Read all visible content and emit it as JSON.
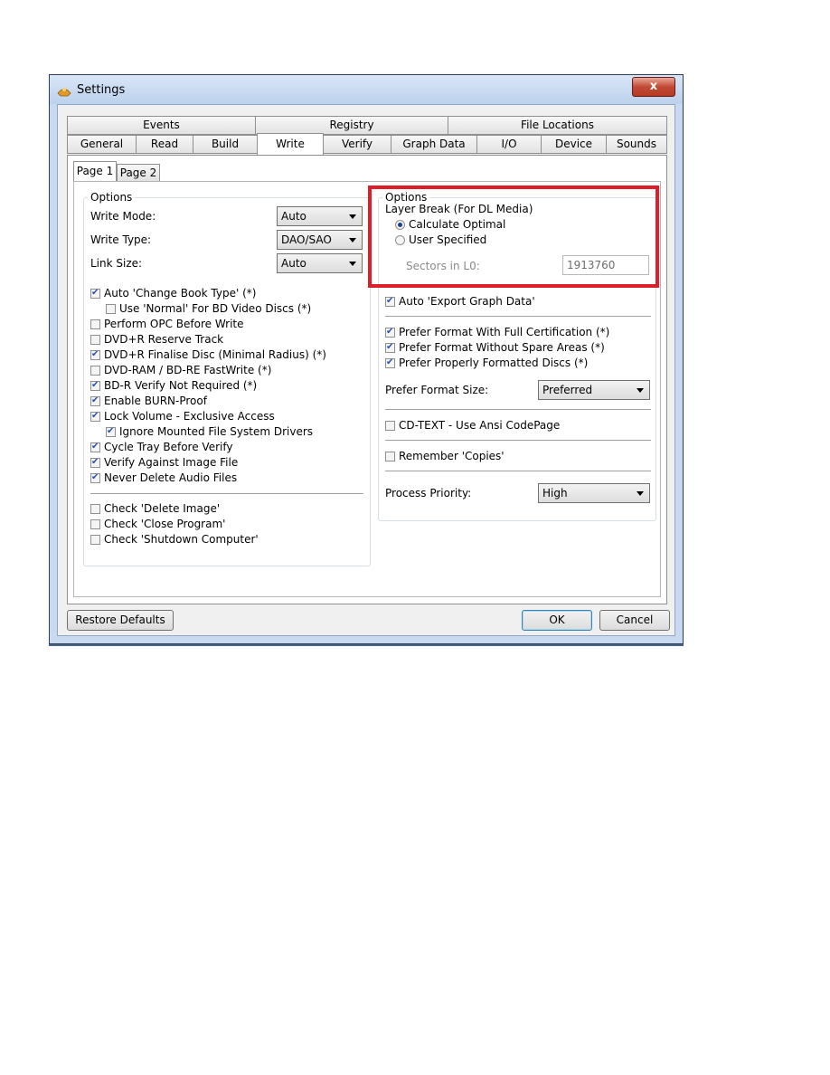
{
  "window": {
    "title": "Settings",
    "close_label": "x"
  },
  "tabs": {
    "row1": [
      "Events",
      "Registry",
      "File Locations"
    ],
    "row2": [
      "General",
      "Read",
      "Build",
      "Write",
      "Verify",
      "Graph Data",
      "I/O",
      "Device",
      "Sounds"
    ],
    "active": "Write"
  },
  "subtabs": [
    "Page 1",
    "Page 2"
  ],
  "left_options": {
    "legend": "Options",
    "write_mode": {
      "label": "Write Mode:",
      "value": "Auto"
    },
    "write_type": {
      "label": "Write Type:",
      "value": "DAO/SAO"
    },
    "link_size": {
      "label": "Link Size:",
      "value": "Auto"
    },
    "checks": [
      {
        "label": "Auto 'Change Book Type' (*)",
        "checked": true
      },
      {
        "label": "Use 'Normal' For BD Video Discs (*)",
        "checked": false
      },
      {
        "label": "Perform OPC Before Write",
        "checked": false
      },
      {
        "label": "DVD+R Reserve Track",
        "checked": false
      },
      {
        "label": "DVD+R Finalise Disc (Minimal Radius) (*)",
        "checked": true
      },
      {
        "label": "DVD-RAM / BD-RE FastWrite (*)",
        "checked": false
      },
      {
        "label": "BD-R Verify Not Required (*)",
        "checked": true
      },
      {
        "label": "Enable BURN-Proof",
        "checked": true
      },
      {
        "label": "Lock Volume - Exclusive Access",
        "checked": true
      },
      {
        "label": "Ignore Mounted File System Drivers",
        "checked": true
      },
      {
        "label": "Cycle Tray Before Verify",
        "checked": true
      },
      {
        "label": "Verify Against Image File",
        "checked": true
      },
      {
        "label": "Never Delete Audio Files",
        "checked": true
      }
    ],
    "checks2": [
      {
        "label": "Check 'Delete Image'",
        "checked": false
      },
      {
        "label": "Check 'Close Program'",
        "checked": false
      },
      {
        "label": "Check 'Shutdown Computer'",
        "checked": false
      }
    ]
  },
  "right_options": {
    "legend": "Options",
    "layer_break_label": "Layer Break (For DL Media)",
    "radio_calculate": "Calculate Optimal",
    "radio_user": "User Specified",
    "selected_radio": "Calculate Optimal",
    "sectors_label": "Sectors in L0:",
    "sectors_value": "1913760",
    "auto_export": {
      "label": "Auto 'Export Graph Data'",
      "checked": true
    },
    "prefer_checks": [
      {
        "label": "Prefer Format With Full Certification (*)",
        "checked": true
      },
      {
        "label": "Prefer Format Without Spare Areas (*)",
        "checked": true
      },
      {
        "label": "Prefer Properly Formatted Discs (*)",
        "checked": true
      }
    ],
    "format_size": {
      "label": "Prefer Format Size:",
      "value": "Preferred"
    },
    "cdtext": {
      "label": "CD-TEXT - Use Ansi CodePage",
      "checked": false
    },
    "remember": {
      "label": "Remember 'Copies'",
      "checked": false
    },
    "priority": {
      "label": "Process Priority:",
      "value": "High"
    }
  },
  "buttons": {
    "restore": "Restore Defaults",
    "ok": "OK",
    "cancel": "Cancel"
  },
  "colors": {
    "highlight_box": "#e01e2b",
    "title_bar": "#c9daf0"
  }
}
